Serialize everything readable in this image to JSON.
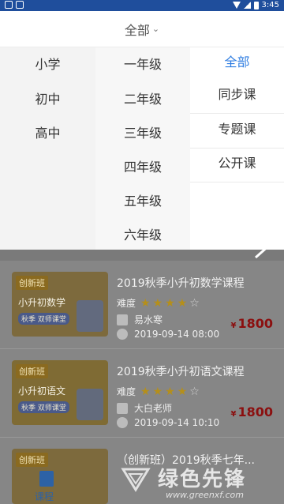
{
  "status_bar": {
    "time": "3:45"
  },
  "header": {
    "title": "全部"
  },
  "filters": {
    "stages": [
      "小学",
      "初中",
      "高中"
    ],
    "grades": [
      "一年级",
      "二年级",
      "三年级",
      "四年级",
      "五年级",
      "六年级"
    ],
    "types": [
      "全部",
      "同步课",
      "专题课",
      "公开课"
    ],
    "selected_type": "全部",
    "accent_color": "#2f7de1"
  },
  "courses": [
    {
      "title": "2019秋季小升初数学课程",
      "difficulty_label": "难度",
      "rating": 4,
      "rating_max": 5,
      "teacher": "易水寒",
      "time": "2019-09-14 08:00",
      "price": "1800",
      "currency": "¥",
      "thumb": {
        "tag": "创新班",
        "name": "小升初数学",
        "sub": "秋季 双师课堂"
      }
    },
    {
      "title": "2019秋季小升初语文课程",
      "difficulty_label": "难度",
      "rating": 4,
      "rating_max": 5,
      "teacher": "大白老师",
      "time": "2019-09-14 10:10",
      "price": "1800",
      "currency": "¥",
      "thumb": {
        "tag": "创新班",
        "name": "小升初语文",
        "sub": "秋季 双师课堂"
      }
    },
    {
      "title": "（创新班）2019秋季七年...",
      "thumb": {
        "tag": "创新班"
      }
    }
  ],
  "tabbar": {
    "active_label": "课程"
  },
  "watermark": {
    "text": "绿色先锋",
    "url": "www.greenxf.com"
  }
}
